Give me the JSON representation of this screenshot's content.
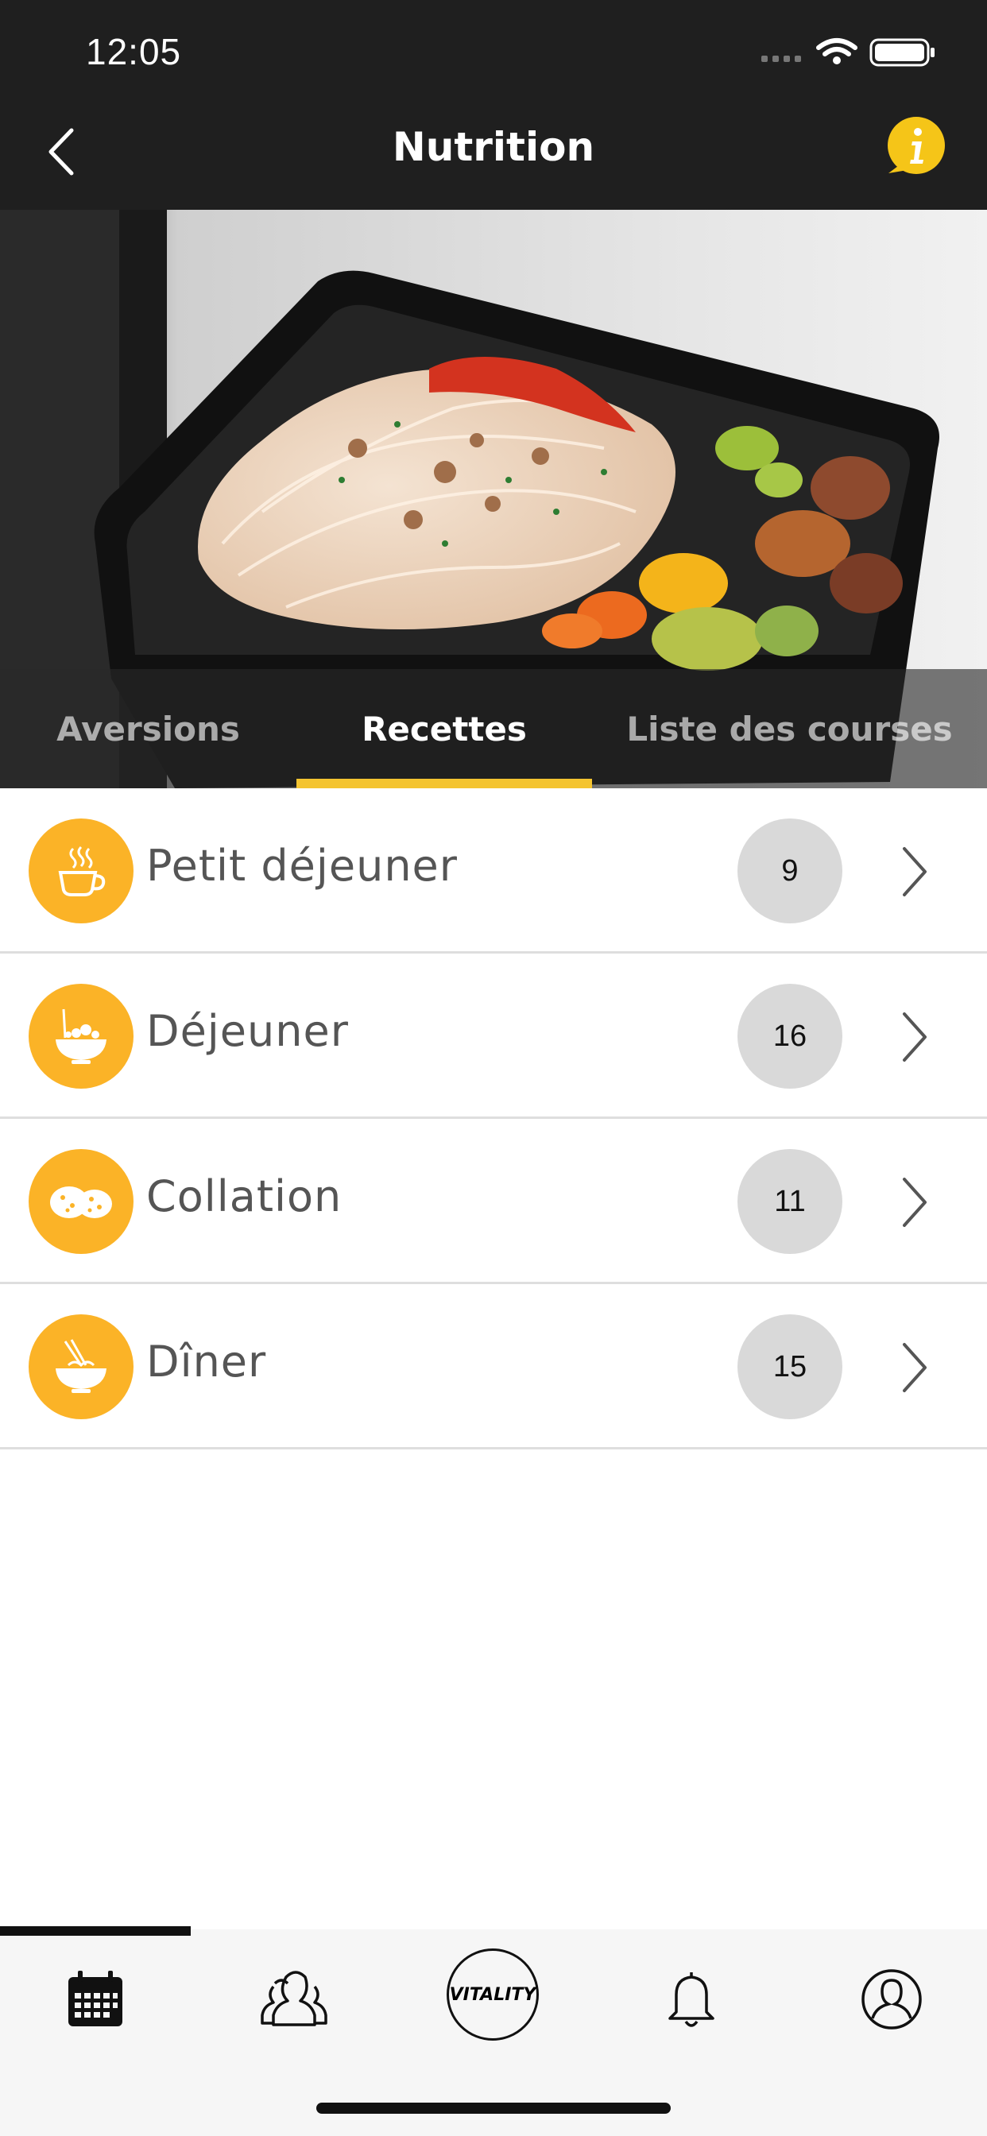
{
  "status_bar": {
    "time": "12:05"
  },
  "header": {
    "title": "Nutrition"
  },
  "hero": {
    "image": "meal-container-photo"
  },
  "tabs": [
    {
      "label": "Aversions",
      "active": false
    },
    {
      "label": "Recettes",
      "active": true
    },
    {
      "label": "Liste des courses",
      "active": false
    }
  ],
  "categories": [
    {
      "label": "Petit déjeuner",
      "count": "9",
      "icon": "coffee-cup-icon"
    },
    {
      "label": "Déjeuner",
      "count": "16",
      "icon": "salad-bowl-icon"
    },
    {
      "label": "Collation",
      "count": "11",
      "icon": "cookies-icon"
    },
    {
      "label": "Dîner",
      "count": "15",
      "icon": "noodle-bowl-icon"
    }
  ],
  "tab_bar": {
    "items": [
      "calendar-icon",
      "group-icon",
      "vitality-logo",
      "bell-icon",
      "profile-icon"
    ],
    "logo_text": "VITALITY"
  },
  "colors": {
    "accent": "#fbb327",
    "tab_underline": "#f4c430",
    "header_bg": "#1f1f1f"
  }
}
